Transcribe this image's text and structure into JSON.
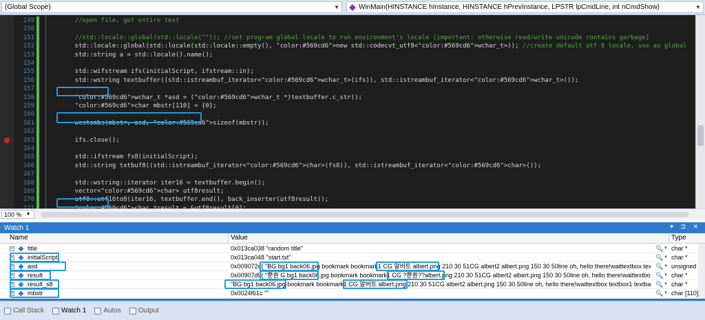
{
  "scope": {
    "left_label": "(Global Scope)",
    "right_label": "WinMain(HINSTANCE hInstance, HINSTANCE hPrevInstance, LPSTR lpCmdLine, int nCmdShow)"
  },
  "code_lines": [
    {
      "num": "149",
      "text": "    //open file, get entire text"
    },
    {
      "num": "150",
      "text": ""
    },
    {
      "num": "151",
      "text": "    //std::locale::global(std::locale(\"\")); //set program global locale to run environment's locale [important: otherwise read/write unicode contains garbage]"
    },
    {
      "num": "152",
      "text": "    std::locale::global(std::locale(std::locale::empty(), new std::codecvt_utf8<wchar_t>)); //create default utf-8 locale, use as global"
    },
    {
      "num": "153",
      "text": "    std::string a = std::locale().name();"
    },
    {
      "num": "154",
      "text": ""
    },
    {
      "num": "155",
      "text": "    std::wifstream ifs(initialScript, ifstream::in);"
    },
    {
      "num": "156",
      "text": "    std::wstring textbuffer((std::istreambuf_iterator<wchar_t>(ifs)), std::istreambuf_iterator<wchar_t>());"
    },
    {
      "num": "157",
      "text": ""
    },
    {
      "num": "158",
      "text": "    wchar_t *asd = (wchar_t *)textbuffer.c_str();"
    },
    {
      "num": "159",
      "text": "    char mbstr[110] = {0};"
    },
    {
      "num": "160",
      "text": ""
    },
    {
      "num": "161",
      "text": "    wcstombs(mbstr, asd, sizeof(mbstr));"
    },
    {
      "num": "162",
      "text": ""
    },
    {
      "num": "163",
      "text": "    ifs.close();"
    },
    {
      "num": "164",
      "text": ""
    },
    {
      "num": "165",
      "text": "    std::ifstream fs8(initialScript);"
    },
    {
      "num": "166",
      "text": "    std::string txtbuf8((std::istreambuf_iterator<char>(fs8)), std::istreambuf_iterator<char>());"
    },
    {
      "num": "167",
      "text": ""
    },
    {
      "num": "168",
      "text": "    std::wstring::iterator iter16 = textbuffer.begin();"
    },
    {
      "num": "169",
      "text": "    vector<char> utf8result;"
    },
    {
      "num": "170",
      "text": "    utf8::utf16to8(iter16, textbuffer.end(), back_inserter(utf8result));"
    },
    {
      "num": "171",
      "text": "    char *result = &utf8result[0];"
    }
  ],
  "breakpoint_line": "163",
  "zoom": "100 %",
  "watch": {
    "title": "Watch 1",
    "columns": {
      "name": "Name",
      "value": "Value",
      "type": "Type"
    },
    "rows": [
      {
        "name": "title",
        "value": "0x013ca038 \"random title\"",
        "type": "char *"
      },
      {
        "name": "initialScript",
        "value": "0x013ca048 \"start.txt\"",
        "type": "char *"
      },
      {
        "name": "asd",
        "value": "0x009072d( \"BG bg1 back06.jpg bookmark bookmark1 CG 알버트 albert.png 210 30 51CG albert2 albert.png 150 30 50line oh, hello there!waittextbox textbo",
        "type": "unsigned"
      },
      {
        "name": "result",
        "value": "0x00907d0( \"뿐퀀 G bg1 back06.jpg bookmark bookmark1 CG ?뿐퀀??albert.png 210 30 51CG albert2 albert.png 150 30 50line oh, hello there!waittextbox tex",
        "type": "char *"
      },
      {
        "name": "result_s8",
        "value": "\"BG bg1 back06.jpg bookmark bookmark1 CG 알버트 albert.png 210 30 51CG albert2 albert.png 150 30 50line oh, hello there!waittextbox textbox1 textbar2.p",
        "type": "char *"
      },
      {
        "name": "mbstr",
        "value": "0x0024f61c \"\"",
        "type": "char [110]"
      }
    ]
  },
  "bottom_tabs": [
    "Call Stack",
    "Watch 1",
    "Autos",
    "Output"
  ]
}
